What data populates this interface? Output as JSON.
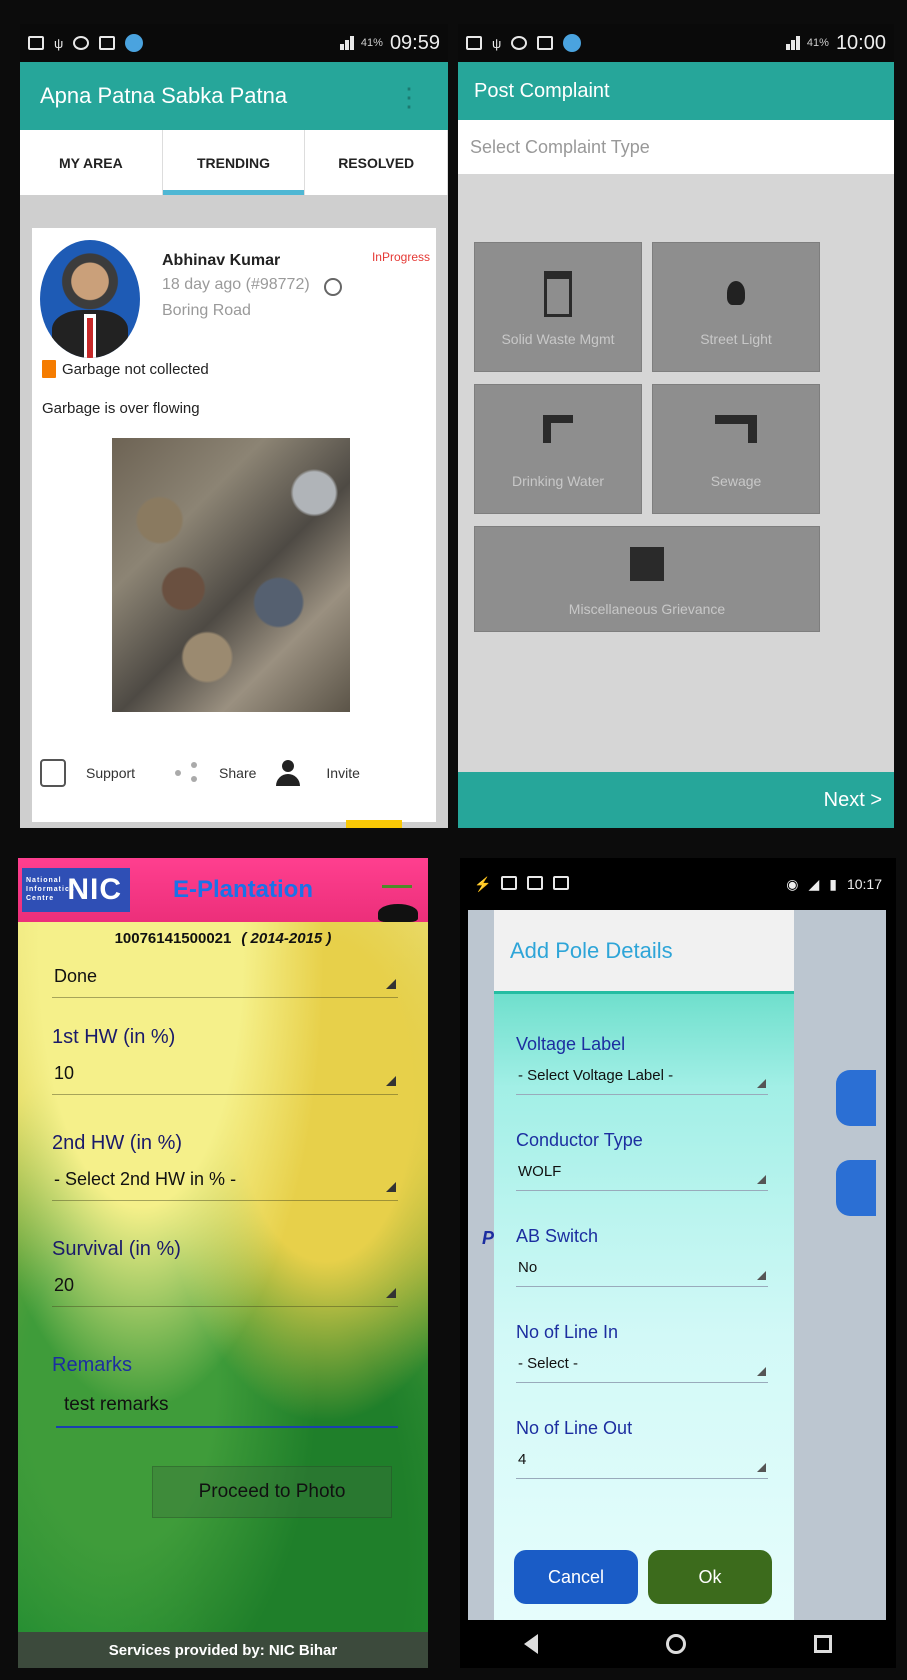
{
  "panel1": {
    "status_time": "09:59",
    "battery": "41%",
    "app_title": "Apna Patna Sabka Patna",
    "tabs": [
      "MY AREA",
      "TRENDING",
      "RESOLVED"
    ],
    "active_tab": "TRENDING",
    "post": {
      "user": "Abhinav Kumar",
      "meta": "18 day ago (#98772)",
      "location": "Boring Road",
      "status": "InProgress",
      "category": "Garbage not collected",
      "description": "Garbage is over flowing",
      "actions": {
        "support": "Support",
        "share": "Share",
        "invite": "Invite"
      }
    }
  },
  "panel2": {
    "status_time": "10:00",
    "battery": "41%",
    "app_title": "Post Complaint",
    "select_placeholder": "Select Complaint Type",
    "tiles": {
      "solid_waste": "Solid Waste Mgmt",
      "street_light": "Street Light",
      "drinking_water": "Drinking Water",
      "sewage": "Sewage",
      "misc": "Miscellaneous Grievance"
    },
    "next": "Next >"
  },
  "panel3": {
    "title": "E-Plantation",
    "logo_text": "NIC",
    "logo_small": "National Informatics Centre",
    "reg_no": "10076141500021",
    "year": "( 2014-2015 )",
    "status_value": "Done",
    "hw1_label": "1st HW (in %)",
    "hw1_value": "10",
    "hw2_label": "2nd HW (in %)",
    "hw2_value": "- Select 2nd HW in % -",
    "survival_label": "Survival (in %)",
    "survival_value": "20",
    "remarks_label": "Remarks",
    "remarks_value": "test remarks",
    "proceed": "Proceed to Photo",
    "footer": "Services provided by: NIC Bihar"
  },
  "panel4": {
    "status_time": "10:17",
    "bg_text": "Po",
    "dialog_title": "Add Pole Details",
    "fields": [
      {
        "label": "Voltage Label",
        "value": "- Select Voltage Label -"
      },
      {
        "label": "Conductor Type",
        "value": "WOLF"
      },
      {
        "label": "AB Switch",
        "value": "No"
      },
      {
        "label": "No of Line In",
        "value": "- Select -"
      },
      {
        "label": "No of Line Out",
        "value": "4"
      }
    ],
    "cancel": "Cancel",
    "ok": "Ok"
  }
}
